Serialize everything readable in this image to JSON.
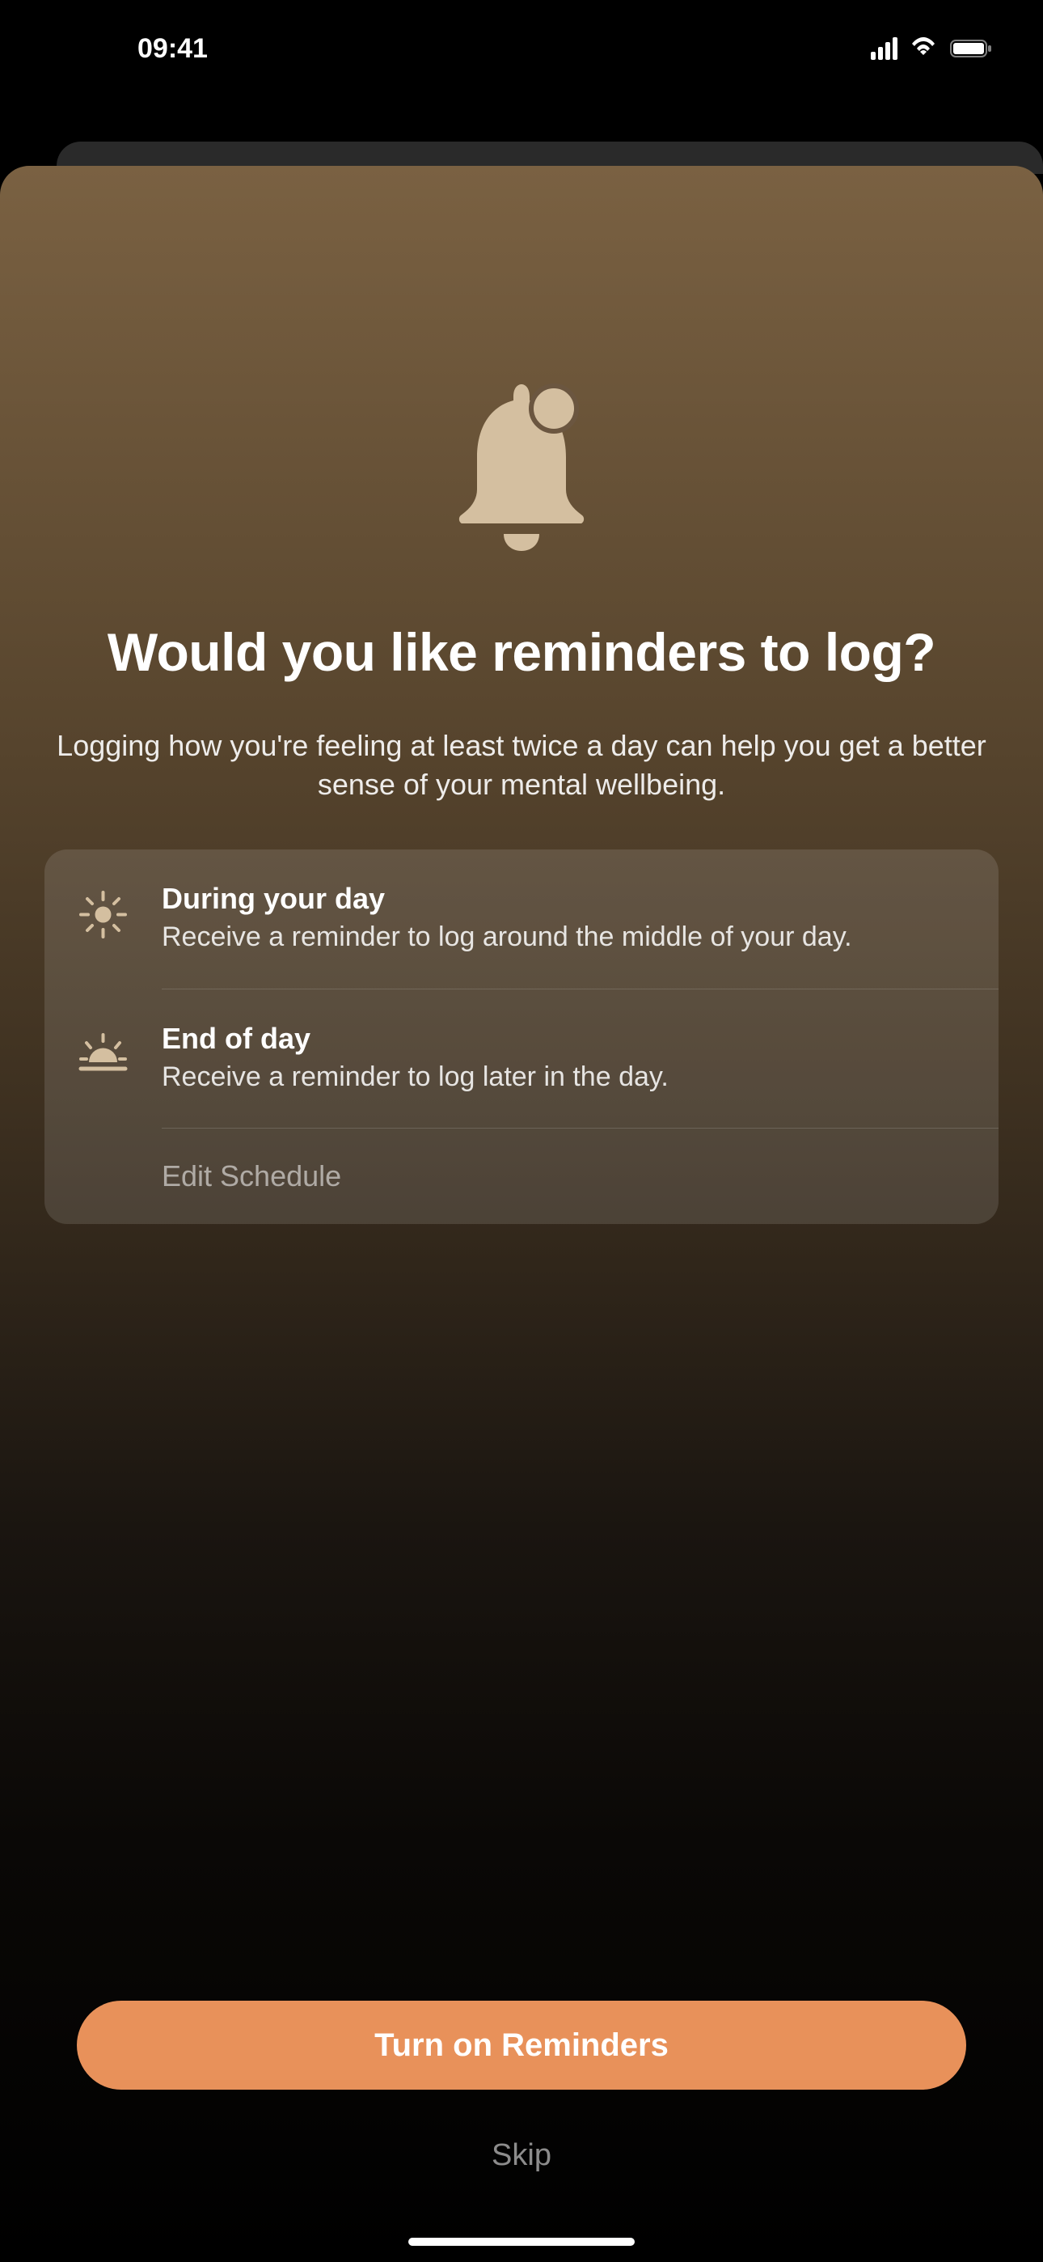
{
  "status": {
    "time": "09:41"
  },
  "icons": {
    "bell": "bell-notification-icon",
    "sun": "sun-icon",
    "sunset": "sunset-icon"
  },
  "title": "Would you like reminders to log?",
  "subtitle": "Logging how you're feeling at least twice a day can help you get a better sense of your mental wellbeing.",
  "options": [
    {
      "title": "During your day",
      "description": "Receive a reminder to log around the middle of your day."
    },
    {
      "title": "End of day",
      "description": "Receive a reminder to log later in the day."
    }
  ],
  "editSchedule": "Edit Schedule",
  "primaryButton": "Turn on Reminders",
  "skipButton": "Skip"
}
